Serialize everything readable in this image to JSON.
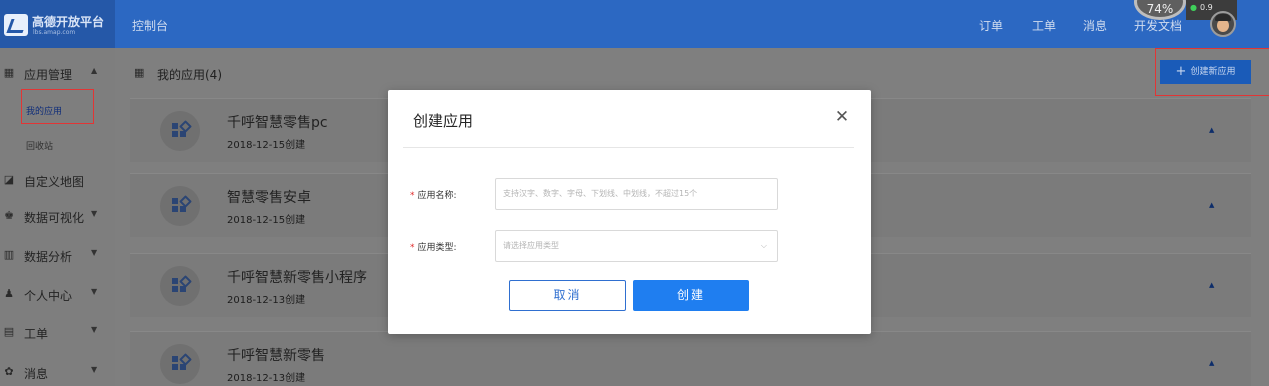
{
  "header": {
    "logo_text": "高德开放平台",
    "logo_sub": "lbs.amap.com",
    "console": "控制台",
    "nav": [
      "订单",
      "工单",
      "消息",
      "开发文档"
    ],
    "speed_percent": "74%",
    "speed_value": "0.9"
  },
  "sidebar": {
    "app_mgmt": {
      "icon": "grid-icon",
      "label": "应用管理"
    },
    "sub_items": [
      "我的应用",
      "回收站"
    ],
    "items": [
      {
        "icon": "map-icon",
        "label": "自定义地图"
      },
      {
        "icon": "chart-icon",
        "label": "数据可视化"
      },
      {
        "icon": "analytics-icon",
        "label": "数据分析"
      },
      {
        "icon": "user-icon",
        "label": "个人中心"
      },
      {
        "icon": "ticket-icon",
        "label": "工单"
      },
      {
        "icon": "message-icon",
        "label": "消息"
      }
    ]
  },
  "main": {
    "title": "我的应用(4)",
    "create_button": "创建新应用",
    "apps": [
      {
        "name": "千呼智慧零售pc",
        "date": "2018-12-15创建"
      },
      {
        "name": "智慧零售安卓",
        "date": "2018-12-15创建"
      },
      {
        "name": "千呼智慧新零售小程序",
        "date": "2018-12-13创建"
      },
      {
        "name": "千呼智慧新零售",
        "date": "2018-12-13创建"
      }
    ]
  },
  "modal": {
    "title": "创建应用",
    "close_symbol": "✕",
    "name_label": "应用名称:",
    "name_placeholder": "支持汉字、数字、字母、下划线、中划线，不超过15个",
    "type_label": "应用类型:",
    "type_placeholder": "请选择应用类型",
    "required_mark": "*",
    "cancel": "取消",
    "create": "创建"
  },
  "colors": {
    "header": "#2c68c2",
    "primary": "#1f7ef0",
    "required": "#e02b2b",
    "highlight_box": "#e23535"
  }
}
